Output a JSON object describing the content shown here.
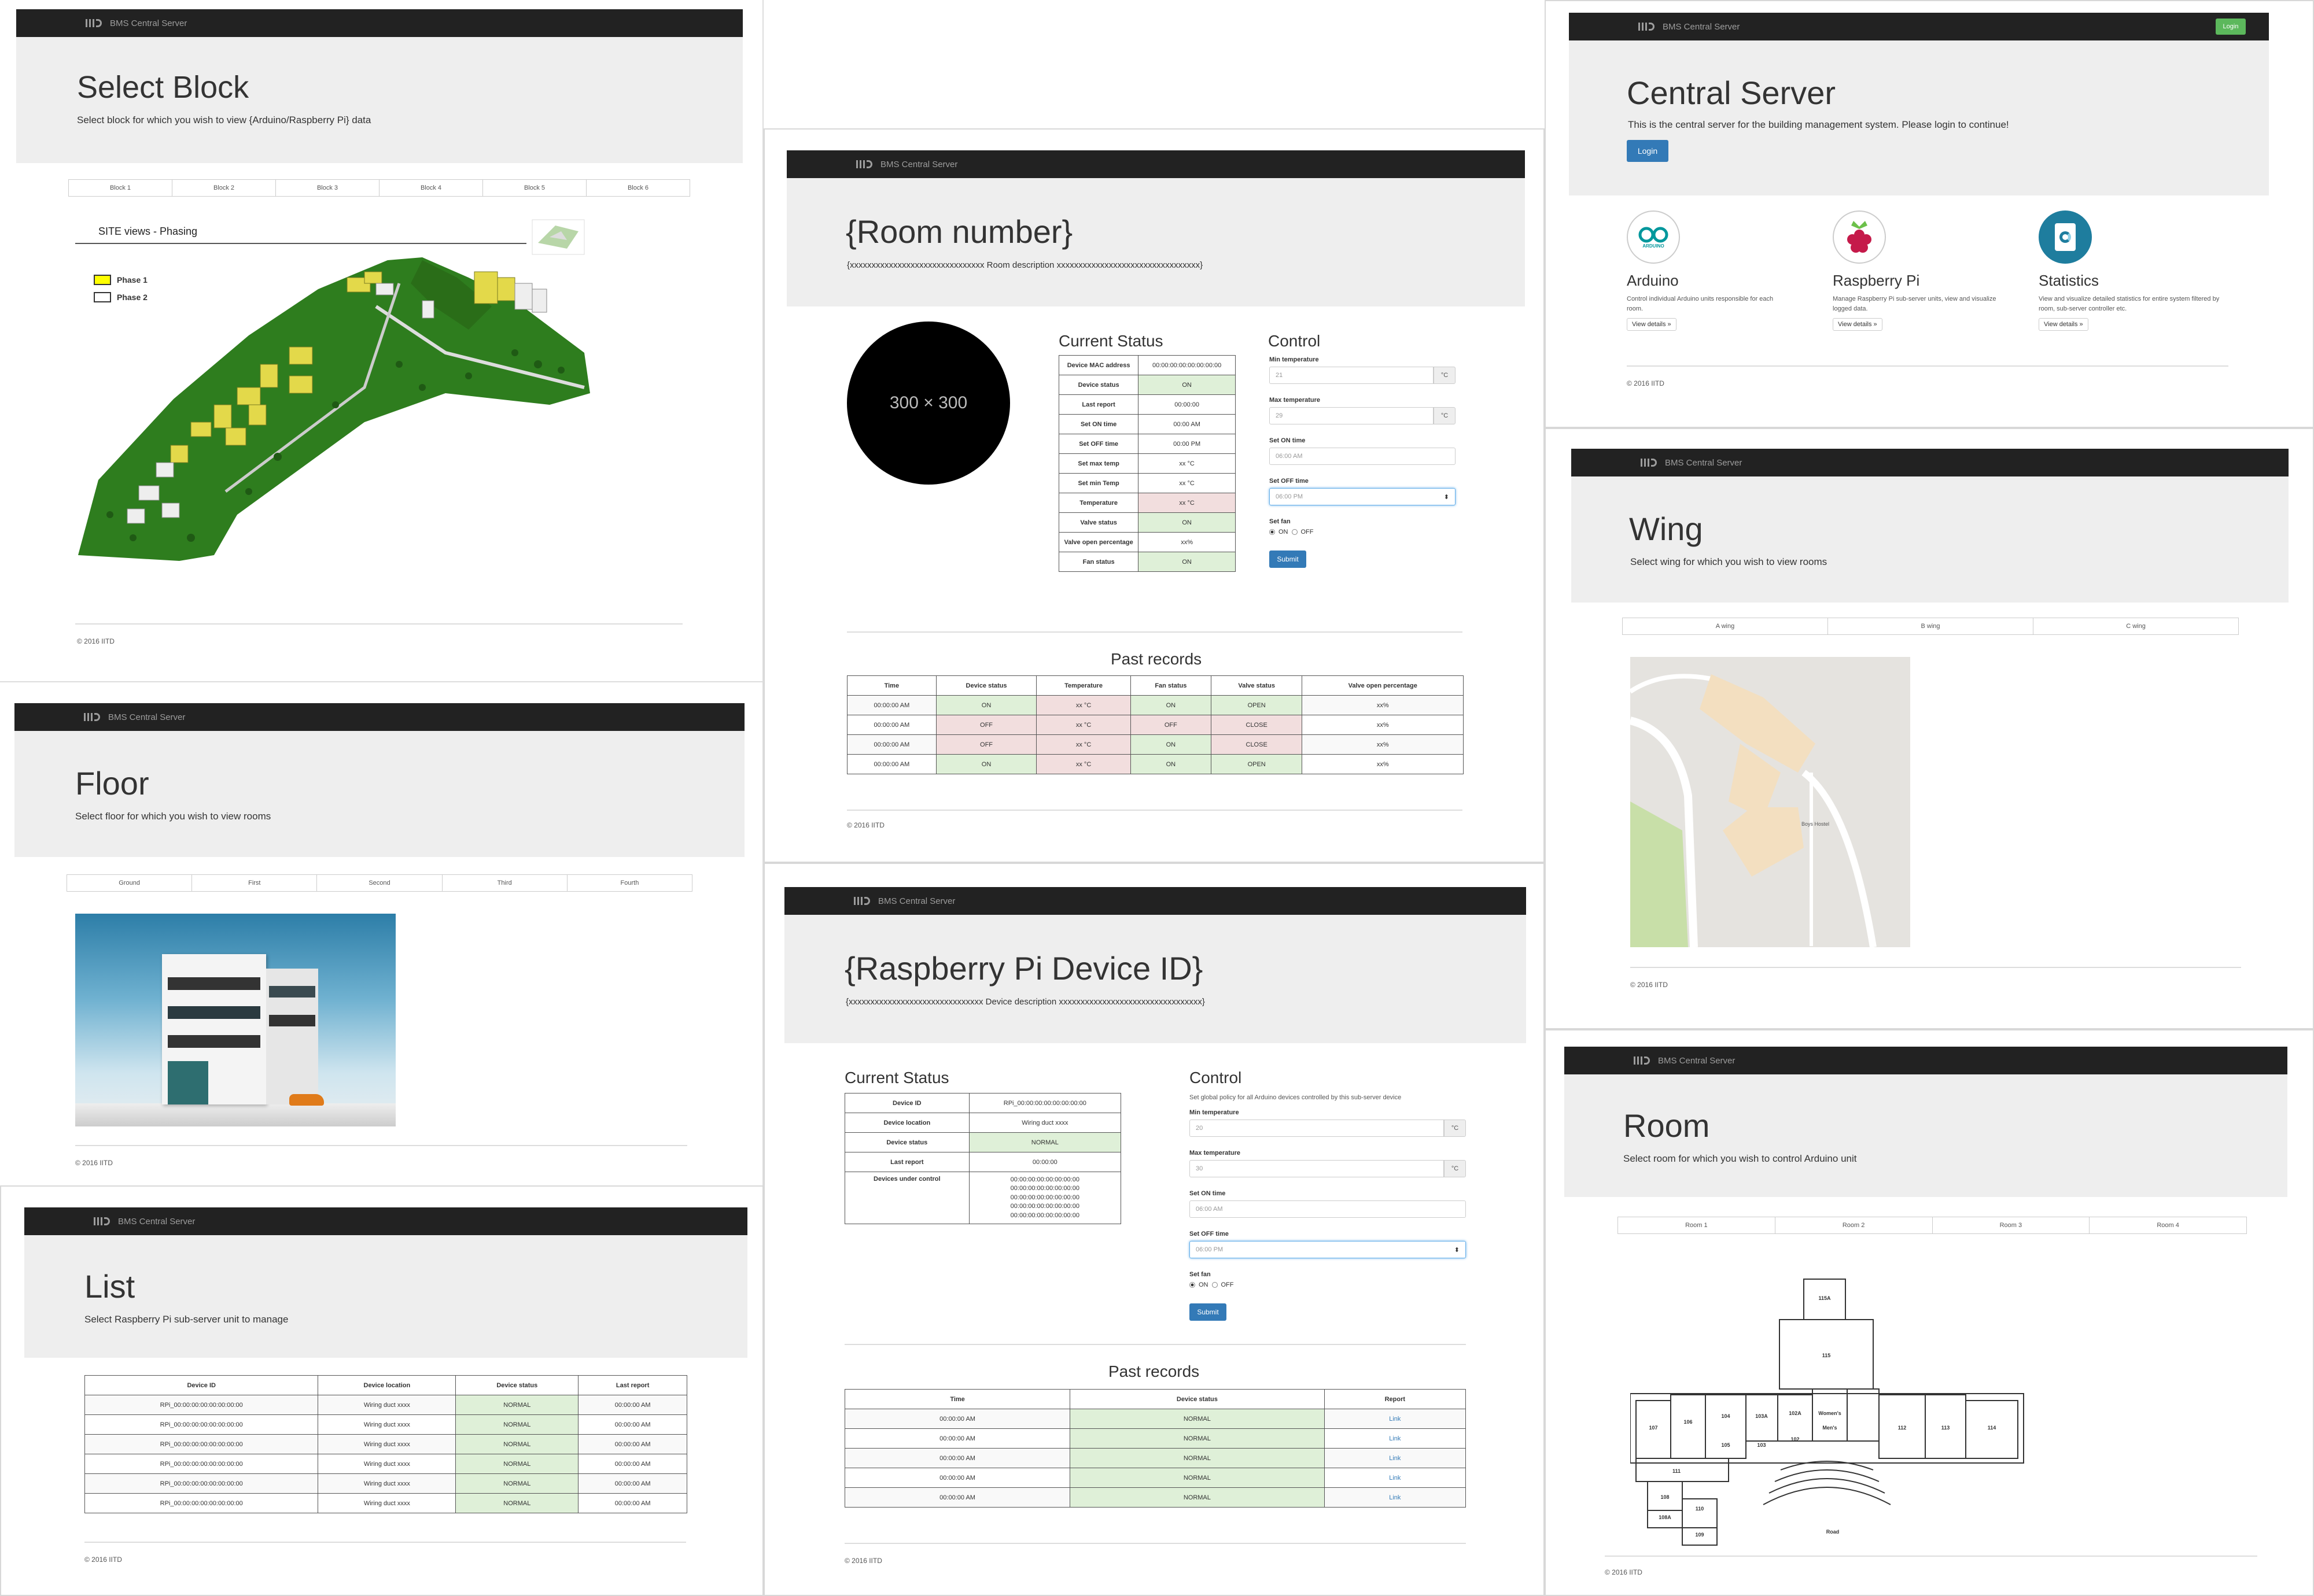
{
  "brand": "BMS Central Server",
  "footer": "© 2016 IITD",
  "select_block": {
    "title": "Select Block",
    "subtitle": "Select block for which you wish to view {Arduino/Raspberry Pi} data",
    "tabs": [
      "Block 1",
      "Block 2",
      "Block 3",
      "Block 4",
      "Block 5",
      "Block 6"
    ],
    "site_title": "SITE views - Phasing",
    "legend": [
      "Phase 1",
      "Phase 2"
    ],
    "legend_colors": [
      "#ffff00",
      "#ffffff"
    ]
  },
  "room_number": {
    "title": "{Room number}",
    "subtitle": "{xxxxxxxxxxxxxxxxxxxxxxxxxxxxxxx Room description xxxxxxxxxxxxxxxxxxxxxxxxxxxxxxxxx}",
    "image_label": "300 × 300",
    "status_title": "Current Status",
    "status_rows": [
      {
        "k": "Device MAC address",
        "v": "00:00:00:00:00:00:00:00",
        "c": ""
      },
      {
        "k": "Device status",
        "v": "ON",
        "c": "g"
      },
      {
        "k": "Last report",
        "v": "00:00:00",
        "c": ""
      },
      {
        "k": "Set ON time",
        "v": "00:00 AM",
        "c": ""
      },
      {
        "k": "Set OFF time",
        "v": "00:00 PM",
        "c": ""
      },
      {
        "k": "Set max temp",
        "v": "xx °C",
        "c": ""
      },
      {
        "k": "Set min Temp",
        "v": "xx °C",
        "c": ""
      },
      {
        "k": "Temperature",
        "v": "xx °C",
        "c": "r"
      },
      {
        "k": "Valve status",
        "v": "ON",
        "c": "g"
      },
      {
        "k": "Valve open percentage",
        "v": "xx%",
        "c": ""
      },
      {
        "k": "Fan status",
        "v": "ON",
        "c": "g"
      }
    ],
    "control_title": "Control",
    "min_temp_label": "Min temperature",
    "min_temp_value": "21",
    "max_temp_label": "Max temperature",
    "max_temp_value": "29",
    "unit": "°C",
    "on_time_label": "Set ON time",
    "on_time_value": "06:00 AM",
    "off_time_label": "Set OFF time",
    "off_time_value": "06:00 PM",
    "fan_label": "Set fan",
    "fan_on": "ON",
    "fan_off": "OFF",
    "submit": "Submit",
    "past_title": "Past records",
    "past_headers": [
      "Time",
      "Device status",
      "Temperature",
      "Fan status",
      "Valve status",
      "Valve open percentage"
    ],
    "past_rows": [
      [
        "00:00:00 AM",
        "ON",
        "xx °C",
        "ON",
        "OPEN",
        "xx%"
      ],
      [
        "00:00:00 AM",
        "OFF",
        "xx °C",
        "OFF",
        "CLOSE",
        "xx%"
      ],
      [
        "00:00:00 AM",
        "OFF",
        "xx °C",
        "ON",
        "CLOSE",
        "xx%"
      ],
      [
        "00:00:00 AM",
        "ON",
        "xx °C",
        "ON",
        "OPEN",
        "xx%"
      ]
    ]
  },
  "central": {
    "login": "Login",
    "title": "Central Server",
    "subtitle": "This is the central server for the building management system. Please login to continue!",
    "login_button": "Login",
    "cards": [
      {
        "title": "Arduino",
        "desc": "Control individual Arduino units responsible for each room.",
        "btn": "View details »",
        "icon": "arduino-icon"
      },
      {
        "title": "Raspberry Pi",
        "desc": "Manage Raspberry Pi sub-server units, view and visualize logged data.",
        "btn": "View details »",
        "icon": "raspberry-pi-icon"
      },
      {
        "title": "Statistics",
        "desc": "View and visualize detailed statistics for entire system filtered by room, sub-server controller etc.",
        "btn": "View details »",
        "icon": "statistics-icon"
      }
    ]
  },
  "floor": {
    "title": "Floor",
    "subtitle": "Select floor for which you wish to view rooms",
    "tabs": [
      "Ground",
      "First",
      "Second",
      "Third",
      "Fourth"
    ]
  },
  "wing": {
    "title": "Wing",
    "subtitle": "Select wing for which you wish to view rooms",
    "tabs": [
      "A wing",
      "B wing",
      "C wing"
    ],
    "map_label": "Boys Hostel"
  },
  "list": {
    "title": "List",
    "subtitle": "Select Raspberry Pi sub-server unit to manage",
    "headers": [
      "Device ID",
      "Device location",
      "Device status",
      "Last report"
    ],
    "rows": [
      [
        "RPi_00:00:00:00:00:00:00:00",
        "Wiring duct xxxx",
        "NORMAL",
        "00:00:00 AM"
      ],
      [
        "RPi_00:00:00:00:00:00:00:00",
        "Wiring duct xxxx",
        "NORMAL",
        "00:00:00 AM"
      ],
      [
        "RPi_00:00:00:00:00:00:00:00",
        "Wiring duct xxxx",
        "NORMAL",
        "00:00:00 AM"
      ],
      [
        "RPi_00:00:00:00:00:00:00:00",
        "Wiring duct xxxx",
        "NORMAL",
        "00:00:00 AM"
      ],
      [
        "RPi_00:00:00:00:00:00:00:00",
        "Wiring duct xxxx",
        "NORMAL",
        "00:00:00 AM"
      ],
      [
        "RPi_00:00:00:00:00:00:00:00",
        "Wiring duct xxxx",
        "NORMAL",
        "00:00:00 AM"
      ]
    ]
  },
  "rpi": {
    "title": "{Raspberry Pi Device ID}",
    "subtitle": "{xxxxxxxxxxxxxxxxxxxxxxxxxxxxxxx Device description xxxxxxxxxxxxxxxxxxxxxxxxxxxxxxxxx}",
    "status_title": "Current Status",
    "status_rows": [
      {
        "k": "Device ID",
        "v": "RPi_00:00:00:00:00:00:00:00",
        "c": ""
      },
      {
        "k": "Device location",
        "v": "Wiring duct xxxx",
        "c": ""
      },
      {
        "k": "Device status",
        "v": "NORMAL",
        "c": "g"
      },
      {
        "k": "Last report",
        "v": "00:00:00",
        "c": ""
      }
    ],
    "devices_label": "Devices under control",
    "devices": [
      "00:00:00:00:00:00:00:00",
      "00:00:00:00:00:00:00:00",
      "00:00:00:00:00:00:00:00",
      "00:00:00:00:00:00:00:00",
      "00:00:00:00:00:00:00:00"
    ],
    "control_title": "Control",
    "control_desc": "Set global policy for all Arduino devices controlled by this sub-server device",
    "min_temp_label": "Min temperature",
    "min_temp_value": "20",
    "max_temp_label": "Max temperature",
    "max_temp_value": "30",
    "unit": "°C",
    "on_time_label": "Set ON time",
    "on_time_value": "06:00 AM",
    "off_time_label": "Set OFF time",
    "off_time_value": "06:00 PM",
    "fan_label": "Set fan",
    "fan_on": "ON",
    "fan_off": "OFF",
    "submit": "Submit",
    "past_title": "Past records",
    "past_headers": [
      "Time",
      "Device status",
      "Report"
    ],
    "past_rows": [
      [
        "00:00:00 AM",
        "NORMAL",
        "Link"
      ],
      [
        "00:00:00 AM",
        "NORMAL",
        "Link"
      ],
      [
        "00:00:00 AM",
        "NORMAL",
        "Link"
      ],
      [
        "00:00:00 AM",
        "NORMAL",
        "Link"
      ],
      [
        "00:00:00 AM",
        "NORMAL",
        "Link"
      ]
    ]
  },
  "room": {
    "title": "Room",
    "subtitle": "Select room for which you wish to control Arduino unit",
    "tabs": [
      "Room 1",
      "Room 2",
      "Room 3",
      "Room 4"
    ],
    "plan_labels": [
      "115A",
      "115",
      "107",
      "106",
      "104",
      "103A",
      "102A",
      "Women's Bathroom",
      "Men's Bathroom",
      "112",
      "113",
      "114",
      "105",
      "103",
      "102",
      "111",
      "108",
      "108A",
      "110",
      "109",
      "Road"
    ]
  }
}
